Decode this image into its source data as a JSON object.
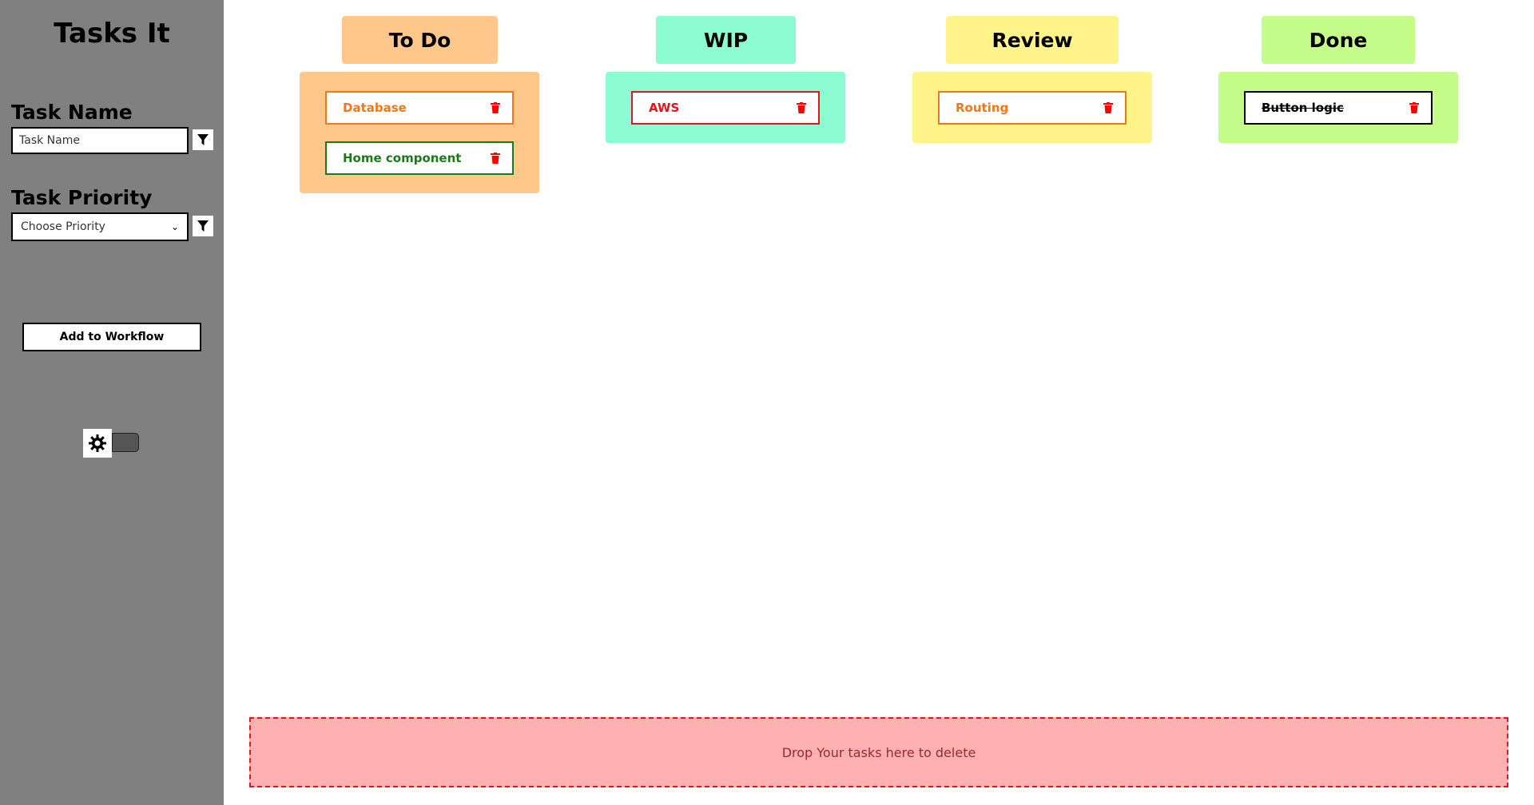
{
  "app": {
    "title": "Tasks It"
  },
  "sidebar": {
    "task_name_label": "Task Name",
    "task_name_placeholder": "Task Name",
    "task_priority_label": "Task Priority",
    "priority_selected": "Choose Priority",
    "add_button_label": "Add to Workflow",
    "filter_icon": "filter-icon",
    "theme_icon": "gear-icon"
  },
  "columns": [
    {
      "title": "To Do",
      "header_color": "#ffc88a",
      "body_color": "#ffc88a",
      "tasks": [
        {
          "label": "Database",
          "color": "#f07818",
          "strike": false
        },
        {
          "label": "Home component",
          "color": "#1a7a1a",
          "strike": false
        }
      ]
    },
    {
      "title": "WIP",
      "header_color": "#8cfdd2",
      "body_color": "#8cfdd2",
      "tasks": [
        {
          "label": "AWS",
          "color": "#e3141b",
          "strike": false
        }
      ]
    },
    {
      "title": "Review",
      "header_color": "#fff38a",
      "body_color": "#fff38a",
      "tasks": [
        {
          "label": "Routing",
          "color": "#f07818",
          "strike": false
        }
      ]
    },
    {
      "title": "Done",
      "header_color": "#c4fd8a",
      "body_color": "#c4fd8a",
      "tasks": [
        {
          "label": "Button logic",
          "color": "#000000",
          "strike": true
        }
      ]
    }
  ],
  "drop_zone": {
    "text": "Drop Your tasks here to delete"
  },
  "colors": {
    "sidebar": "#808080",
    "delete_icon": "#ff0000"
  }
}
